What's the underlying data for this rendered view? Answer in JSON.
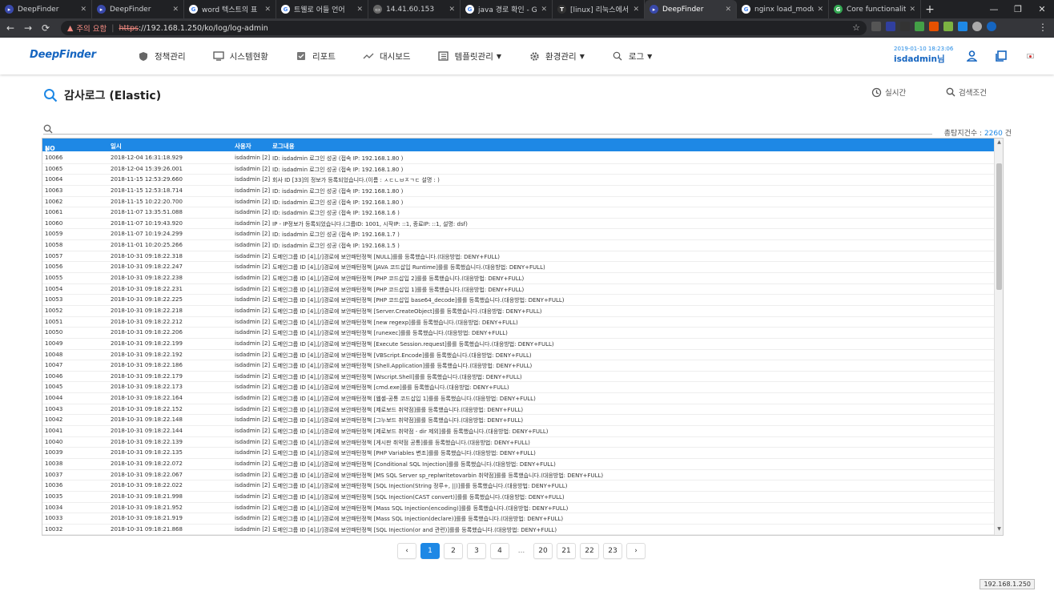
{
  "browser": {
    "tabs": [
      {
        "title": "DeepFinder",
        "fav": "df",
        "active": false
      },
      {
        "title": "DeepFinder",
        "fav": "df",
        "active": false
      },
      {
        "title": "word 텍스트의 표",
        "fav": "g",
        "active": false
      },
      {
        "title": "트웰로 어들 언어",
        "fav": "g",
        "active": false
      },
      {
        "title": "14.41.60.153",
        "fav": "doc",
        "active": false
      },
      {
        "title": "java 경로 확인 - G",
        "fav": "g",
        "active": false
      },
      {
        "title": "[linux] 리눅스에서",
        "fav": "t",
        "active": false
      },
      {
        "title": "DeepFinder",
        "fav": "df",
        "active": true
      },
      {
        "title": "nginx load_module",
        "fav": "g",
        "active": false
      },
      {
        "title": "Core functionality",
        "fav": "gr",
        "active": false
      }
    ],
    "url_warning": "주의 요함",
    "url_scheme": "https",
    "url_rest": "://192.168.1.250/ko/log/log-admin",
    "status_url": "192.168.1.250"
  },
  "app": {
    "logo": "DeepFinder",
    "nav": [
      {
        "label": "정책관리",
        "icon": "shield-icon",
        "caret": false
      },
      {
        "label": "시스템현황",
        "icon": "monitor-icon",
        "caret": false
      },
      {
        "label": "리포트",
        "icon": "report-icon",
        "caret": false
      },
      {
        "label": "대시보드",
        "icon": "trend-icon",
        "caret": false
      },
      {
        "label": "템플릿관리",
        "icon": "template-icon",
        "caret": true
      },
      {
        "label": "환경관리",
        "icon": "gear-icon",
        "caret": true
      },
      {
        "label": "로그",
        "icon": "search-icon",
        "caret": true
      }
    ],
    "timestamp": "2019-01-10 18:23:06",
    "username": "isdadmin님",
    "accent": "#1e88e5"
  },
  "page": {
    "title": "감사로그 (Elastic)",
    "realtime": "실시간",
    "search_cond": "검색조건",
    "count_label": "총탐지건수 : ",
    "count_value": "2260",
    "count_unit": " 건"
  },
  "table": {
    "headers": [
      "NO",
      "일시",
      "사용자",
      "로그내용"
    ],
    "rows": [
      [
        "10066",
        "2018-12-04 16:31:18.929",
        "isdadmin [2]",
        "ID: isdadmin 로그인 성공 (접속 IP: 192.168.1.80 )"
      ],
      [
        "10065",
        "2018-12-04 15:39:26.001",
        "isdadmin [2]",
        "ID: isdadmin 로그인 성공 (접속 IP: 192.168.1.80 )"
      ],
      [
        "10064",
        "2018-11-15 12:53:29.660",
        "isdadmin [2]",
        "회사 ID [33]의 정보가 등록되었습니다.(이름 : ㅅㄷㄴㅂㅈㄱㄷ 설명 : )"
      ],
      [
        "10063",
        "2018-11-15 12:53:18.714",
        "isdadmin [2]",
        "ID: isdadmin 로그인 성공 (접속 IP: 192.168.1.80 )"
      ],
      [
        "10062",
        "2018-11-15 10:22:20.700",
        "isdadmin [2]",
        "ID: isdadmin 로그인 성공 (접속 IP: 192.168.1.80 )"
      ],
      [
        "10061",
        "2018-11-07 13:35:51.088",
        "isdadmin [2]",
        "ID: isdadmin 로그인 성공 (접속 IP: 192.168.1.6 )"
      ],
      [
        "10060",
        "2018-11-07 10:19:43.920",
        "isdadmin [2]",
        "IP - IP정보가 등록되었습니다.(그룹ID: 1001, 시작IP: ::1, 종료IP: ::1, 설명: dsf)"
      ],
      [
        "10059",
        "2018-11-07 10:19:24.299",
        "isdadmin [2]",
        "ID: isdadmin 로그인 성공 (접속 IP: 192.168.1.7 )"
      ],
      [
        "10058",
        "2018-11-01 10:20:25.266",
        "isdadmin [2]",
        "ID: isdadmin 로그인 성공 (접속 IP: 192.168.1.5 )"
      ],
      [
        "10057",
        "2018-10-31 09:18:22.318",
        "isdadmin [2]",
        "도메인그룹 ID [4],[/]경로에 보안패턴정책 [NULL]를를 등록했습니다.(대응방법: DENY+FULL)"
      ],
      [
        "10056",
        "2018-10-31 09:18:22.247",
        "isdadmin [2]",
        "도메인그룹 ID [4],[/]경로에 보안패턴정책 [JAVA 코드삽입 Runtime]를를 등록했습니다.(대응방법: DENY+FULL)"
      ],
      [
        "10055",
        "2018-10-31 09:18:22.238",
        "isdadmin [2]",
        "도메인그룹 ID [4],[/]경로에 보안패턴정책 [PHP 코드삽입 2]를를 등록했습니다.(대응방법: DENY+FULL)"
      ],
      [
        "10054",
        "2018-10-31 09:18:22.231",
        "isdadmin [2]",
        "도메인그룹 ID [4],[/]경로에 보안패턴정책 [PHP 코드삽입 1]를를 등록했습니다.(대응방법: DENY+FULL)"
      ],
      [
        "10053",
        "2018-10-31 09:18:22.225",
        "isdadmin [2]",
        "도메인그룹 ID [4],[/]경로에 보안패턴정책 [PHP 코드삽입 base64_decode]를를 등록했습니다.(대응방법: DENY+FULL)"
      ],
      [
        "10052",
        "2018-10-31 09:18:22.218",
        "isdadmin [2]",
        "도메인그룹 ID [4],[/]경로에 보안패턴정책 [Server.CreateObject]를를 등록했습니다.(대응방법: DENY+FULL)"
      ],
      [
        "10051",
        "2018-10-31 09:18:22.212",
        "isdadmin [2]",
        "도메인그룹 ID [4],[/]경로에 보안패턴정책 [new regexp]를를 등록했습니다.(대응방법: DENY+FULL)"
      ],
      [
        "10050",
        "2018-10-31 09:18:22.206",
        "isdadmin [2]",
        "도메인그룹 ID [4],[/]경로에 보안패턴정책 [runexec]를를 등록했습니다.(대응방법: DENY+FULL)"
      ],
      [
        "10049",
        "2018-10-31 09:18:22.199",
        "isdadmin [2]",
        "도메인그룹 ID [4],[/]경로에 보안패턴정책 [Execute Session.request]를를 등록했습니다.(대응방법: DENY+FULL)"
      ],
      [
        "10048",
        "2018-10-31 09:18:22.192",
        "isdadmin [2]",
        "도메인그룹 ID [4],[/]경로에 보안패턴정책 [VBScript.Encode]를를 등록했습니다.(대응방법: DENY+FULL)"
      ],
      [
        "10047",
        "2018-10-31 09:18:22.186",
        "isdadmin [2]",
        "도메인그룹 ID [4],[/]경로에 보안패턴정책 [Shell.Application]를를 등록했습니다.(대응방법: DENY+FULL)"
      ],
      [
        "10046",
        "2018-10-31 09:18:22.179",
        "isdadmin [2]",
        "도메인그룹 ID [4],[/]경로에 보안패턴정책 [Wscript.Shell]를를 등록했습니다.(대응방법: DENY+FULL)"
      ],
      [
        "10045",
        "2018-10-31 09:18:22.173",
        "isdadmin [2]",
        "도메인그룹 ID [4],[/]경로에 보안패턴정책 [cmd.exe]를를 등록했습니다.(대응방법: DENY+FULL)"
      ],
      [
        "10044",
        "2018-10-31 09:18:22.164",
        "isdadmin [2]",
        "도메인그룹 ID [4],[/]경로에 보안패턴정책 [웹셸-공통 코드삽입 1]를를 등록했습니다.(대응방법: DENY+FULL)"
      ],
      [
        "10043",
        "2018-10-31 09:18:22.152",
        "isdadmin [2]",
        "도메인그룹 ID [4],[/]경로에 보안패턴정책 [제로보드 취약점]를를 등록했습니다.(대응방법: DENY+FULL)"
      ],
      [
        "10042",
        "2018-10-31 09:18:22.148",
        "isdadmin [2]",
        "도메인그룹 ID [4],[/]경로에 보안패턴정책 [그누보드 취약점]를를 등록했습니다.(대응방법: DENY+FULL)"
      ],
      [
        "10041",
        "2018-10-31 09:18:22.144",
        "isdadmin [2]",
        "도메인그룹 ID [4],[/]경로에 보안패턴정책 [제로보드 취약점 - dir 제외]를를 등록했습니다.(대응방법: DENY+FULL)"
      ],
      [
        "10040",
        "2018-10-31 09:18:22.139",
        "isdadmin [2]",
        "도메인그룹 ID [4],[/]경로에 보안패턴정책 [게시판 취약점 공통]를를 등록했습니다.(대응방법: DENY+FULL)"
      ],
      [
        "10039",
        "2018-10-31 09:18:22.135",
        "isdadmin [2]",
        "도메인그룹 ID [4],[/]경로에 보안패턴정책 [PHP Variables 변조]를를 등록했습니다.(대응방법: DENY+FULL)"
      ],
      [
        "10038",
        "2018-10-31 09:18:22.072",
        "isdadmin [2]",
        "도메인그룹 ID [4],[/]경로에 보안패턴정책 [Conditional SQL Injection]를를 등록했습니다.(대응방법: DENY+FULL)"
      ],
      [
        "10037",
        "2018-10-31 09:18:22.067",
        "isdadmin [2]",
        "도메인그룹 ID [4],[/]경로에 보안패턴정책 [MS SQL Server sp_replwritetovarbin 취약점]를를 등록했습니다.(대응방법: DENY+FULL)"
      ],
      [
        "10036",
        "2018-10-31 09:18:22.022",
        "isdadmin [2]",
        "도메인그룹 ID [4],[/]경로에 보안패턴정책 [SQL Injection(String 정루+, ||)]를를 등록했습니다.(대응방법: DENY+FULL)"
      ],
      [
        "10035",
        "2018-10-31 09:18:21.998",
        "isdadmin [2]",
        "도메인그룹 ID [4],[/]경로에 보안패턴정책 [SQL Injection(CAST convert)]를를 등록했습니다.(대응방법: DENY+FULL)"
      ],
      [
        "10034",
        "2018-10-31 09:18:21.952",
        "isdadmin [2]",
        "도메인그룹 ID [4],[/]경로에 보안패턴정책 [Mass SQL Injection(encoding)]를를 등록했습니다.(대응방법: DENY+FULL)"
      ],
      [
        "10033",
        "2018-10-31 09:18:21.919",
        "isdadmin [2]",
        "도메인그룹 ID [4],[/]경로에 보안패턴정책 [Mass SQL Injection(declare)]를를 등록했습니다.(대응방법: DENY+FULL)"
      ],
      [
        "10032",
        "2018-10-31 09:18:21.868",
        "isdadmin [2]",
        "도메인그룹 ID [4],[/]경로에 보안패턴정책 [SQL Injection(or and 관련)]를를 등록했습니다.(대응방법: DENY+FULL)"
      ]
    ]
  },
  "pagination": {
    "pages": [
      "1",
      "2",
      "3",
      "4",
      "...",
      "20",
      "21",
      "22",
      "23"
    ],
    "active": "1"
  }
}
